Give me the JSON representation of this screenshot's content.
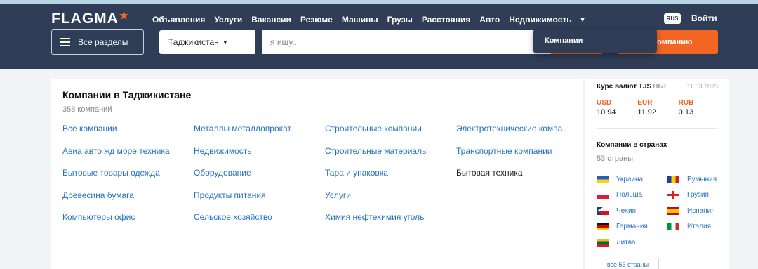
{
  "header": {
    "logo": "FLAGMA",
    "nav": [
      "Объявления",
      "Услуги",
      "Вакансии",
      "Резюме",
      "Машины",
      "Грузы",
      "Расстояния",
      "Авто",
      "Недвижимость"
    ],
    "nav_more_icon": "caret-down-icon",
    "lang": "RUS",
    "login": "Войти"
  },
  "searchbar": {
    "sections_label": "Все разделы",
    "country": "Таджикистан",
    "placeholder": "я ищу...",
    "add_company": "ть компанию"
  },
  "dropdown": {
    "item": "Компании"
  },
  "main": {
    "title": "Компании в Таджикистане",
    "count": "358 компаний",
    "categories": [
      {
        "label": "Все компании",
        "link": true
      },
      {
        "label": "Металлы металлопрокат",
        "link": true
      },
      {
        "label": "Строительные компании",
        "link": true
      },
      {
        "label": "Электротехнические компа...",
        "link": true
      },
      {
        "label": "Авиа авто жд море техника",
        "link": true
      },
      {
        "label": "Недвижимость",
        "link": true
      },
      {
        "label": "Строительные материалы",
        "link": true
      },
      {
        "label": "Транспортные компании",
        "link": true
      },
      {
        "label": "Бытовые товары одежда",
        "link": true
      },
      {
        "label": "Оборудование",
        "link": true
      },
      {
        "label": "Тара и упаковка",
        "link": true
      },
      {
        "label": "Бытовая техника",
        "link": false
      },
      {
        "label": "Древесина бумага",
        "link": true
      },
      {
        "label": "Продукты питания",
        "link": true
      },
      {
        "label": "Услуги",
        "link": true
      },
      {
        "label": "",
        "link": false
      },
      {
        "label": "Компьютеры офис",
        "link": true
      },
      {
        "label": "Сельское хозяйство",
        "link": true
      },
      {
        "label": "Химия нефтехимия уголь",
        "link": true
      },
      {
        "label": "",
        "link": false
      }
    ]
  },
  "rates": {
    "title": "Курс валют TJS",
    "source": "НБТ",
    "date": "11.03.2025",
    "currencies": [
      {
        "code": "USD",
        "value": "10.94"
      },
      {
        "code": "EUR",
        "value": "11.92"
      },
      {
        "code": "RUB",
        "value": "0.13"
      }
    ]
  },
  "countries": {
    "title": "Компании в странах",
    "count": "53 страны",
    "items": [
      {
        "name": "Украина",
        "flag": [
          "#1f5fc8",
          "#ffd500"
        ],
        "dir": "h"
      },
      {
        "name": "Румыния",
        "flag": [
          "#1a3fa8",
          "#ffd500",
          "#d21f2b"
        ],
        "dir": "v"
      },
      {
        "name": "Польша",
        "flag": [
          "#ffffff",
          "#dc1c3a"
        ],
        "dir": "h"
      },
      {
        "name": "Грузия",
        "flag": [
          "#ffffff",
          "#e02020"
        ],
        "dir": "cross"
      },
      {
        "name": "Чехия",
        "flag": [
          "#ffffff",
          "#d7141a",
          "#11457e"
        ],
        "dir": "czech"
      },
      {
        "name": "Испания",
        "flag": [
          "#c60b1e",
          "#ffc400",
          "#c60b1e"
        ],
        "dir": "spain"
      },
      {
        "name": "Германия",
        "flag": [
          "#111111",
          "#dd0000",
          "#ffce00"
        ],
        "dir": "h"
      },
      {
        "name": "Италия",
        "flag": [
          "#009246",
          "#ffffff",
          "#ce2b37"
        ],
        "dir": "v"
      },
      {
        "name": "Литва",
        "flag": [
          "#fdb913",
          "#006a44",
          "#c1272d"
        ],
        "dir": "h"
      }
    ],
    "all_label": "все 53 страны"
  }
}
